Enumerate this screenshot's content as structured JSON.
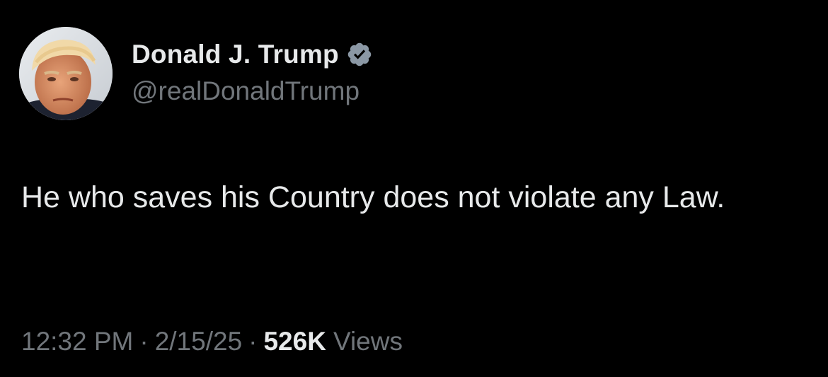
{
  "author": {
    "display_name": "Donald J. Trump",
    "handle": "@realDonaldTrump",
    "verified_icon": "verified-badge-icon",
    "avatar_icon": "profile-photo"
  },
  "tweet": {
    "text": "He who saves his Country does not violate any Law."
  },
  "meta": {
    "time": "12:32 PM",
    "separator": "·",
    "date": "2/15/25",
    "views_count": "526K",
    "views_label": "Views"
  },
  "colors": {
    "background": "#000000",
    "primary_text": "#e7e9ea",
    "secondary_text": "#71767b",
    "verified_badge": "#8b98a5"
  }
}
